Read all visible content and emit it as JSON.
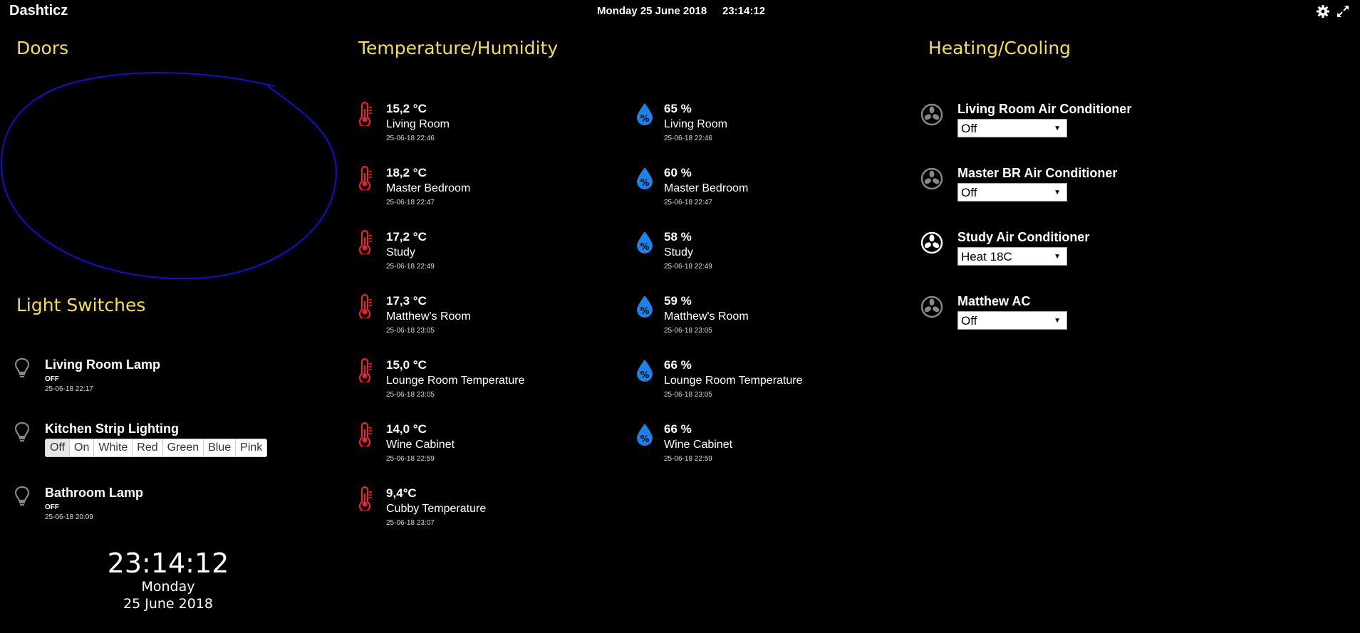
{
  "header": {
    "brand": "Dashticz",
    "date": "Monday 25 June 2018",
    "time": "23:14:12"
  },
  "sections": {
    "doors": "Doors",
    "lights": "Light Switches",
    "temp": "Temperature/Humidity",
    "heating": "Heating/Cooling"
  },
  "colors": {
    "title": "#f5df4d",
    "thermometer": "#e8262a",
    "humidity": "#1e82e8",
    "annotation": "#1010d0"
  },
  "temperatures": [
    {
      "value": "15,2 °C",
      "name": "Living Room",
      "ts": "25-06-18 22:46"
    },
    {
      "value": "18,2 °C",
      "name": "Master Bedroom",
      "ts": "25-06-18 22:47"
    },
    {
      "value": "17,2 °C",
      "name": "Study",
      "ts": "25-06-18 22:49"
    },
    {
      "value": "17,3 °C",
      "name": "Matthew's Room",
      "ts": "25-06-18 23:05"
    },
    {
      "value": "15,0 °C",
      "name": "Lounge Room Temperature",
      "ts": "25-06-18 23:05"
    },
    {
      "value": "14,0 °C",
      "name": "Wine Cabinet",
      "ts": "25-06-18 22:59"
    },
    {
      "value": "9,4°C",
      "name": "Cubby Temperature",
      "ts": "25-06-18 23:07"
    }
  ],
  "humidity": [
    {
      "value": "65 %",
      "name": "Living Room",
      "ts": "25-06-18 22:46"
    },
    {
      "value": "60 %",
      "name": "Master Bedroom",
      "ts": "25-06-18 22:47"
    },
    {
      "value": "58 %",
      "name": "Study",
      "ts": "25-06-18 22:49"
    },
    {
      "value": "59 %",
      "name": "Matthew's Room",
      "ts": "25-06-18 23:05"
    },
    {
      "value": "66 %",
      "name": "Lounge Room Temperature",
      "ts": "25-06-18 23:05"
    },
    {
      "value": "66 %",
      "name": "Wine Cabinet",
      "ts": "25-06-18 22:59"
    }
  ],
  "lights": [
    {
      "name": "Living Room Lamp",
      "state": "OFF",
      "ts": "25-06-18 22:17"
    },
    {
      "name": "Kitchen Strip Lighting",
      "buttons": [
        "Off",
        "On",
        "White",
        "Red",
        "Green",
        "Blue",
        "Pink"
      ],
      "active": "Off"
    },
    {
      "name": "Bathroom Lamp",
      "state": "OFF",
      "ts": "25-06-18 20:09"
    }
  ],
  "hvac": [
    {
      "name": "Living Room Air Conditioner",
      "mode": "Off"
    },
    {
      "name": "Master BR Air Conditioner",
      "mode": "Off"
    },
    {
      "name": "Study Air Conditioner",
      "mode": "Heat 18C"
    },
    {
      "name": "Matthew AC",
      "mode": "Off"
    }
  ],
  "clock": {
    "time": "23:14:12",
    "day": "Monday",
    "date": "25 June 2018"
  }
}
